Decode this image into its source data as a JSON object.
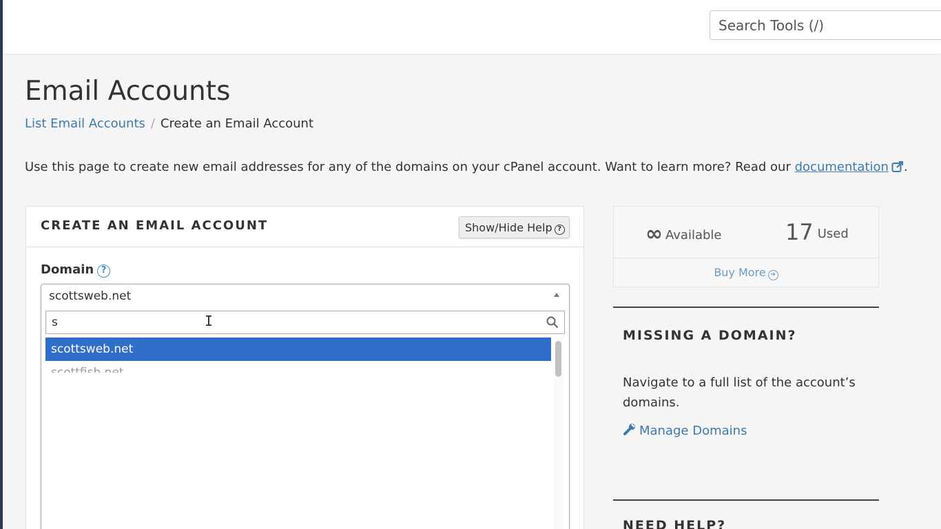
{
  "header": {
    "search_placeholder": "Search Tools (/)"
  },
  "page": {
    "title": "Email Accounts",
    "breadcrumb": {
      "parent": "List Email Accounts",
      "separator": "/",
      "current": "Create an Email Account"
    },
    "intro": {
      "text": "Use this page to create new email addresses for any of the domains on your cPanel account. Want to learn more? Read our",
      "link": "documentation",
      "trailing": "."
    }
  },
  "create_panel": {
    "title": "CREATE AN EMAIL ACCOUNT",
    "help_button": "Show/Hide Help",
    "domain_label": "Domain",
    "domain_select": {
      "current": "scottsweb.net",
      "filter_value": "s",
      "options": [
        "scottsweb.net",
        "scottfish.net"
      ]
    }
  },
  "sidebar": {
    "stats": {
      "available_symbol": "∞",
      "available_label": "Available",
      "used_count": "17",
      "used_label": "Used",
      "buy_more": "Buy More"
    },
    "missing_domain": {
      "title": "MISSING A DOMAIN?",
      "text": "Navigate to a full list of the account’s domains.",
      "link": "Manage Domains"
    },
    "need_help": {
      "title": "NEED HELP?"
    }
  },
  "colors": {
    "link": "#3b7bb3",
    "selected_option": "#2f6ec9",
    "help_icon": "#3b8fd0"
  }
}
